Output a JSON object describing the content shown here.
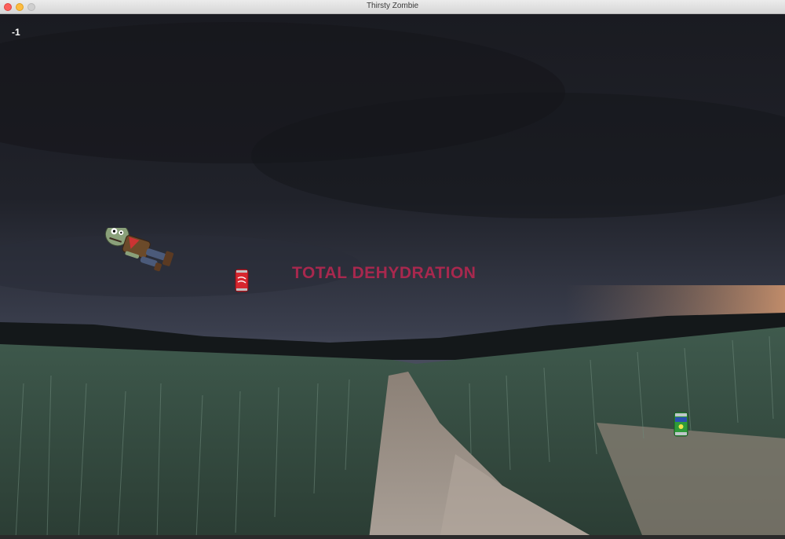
{
  "window": {
    "title": "Thirsty Zombie"
  },
  "hud": {
    "score": "-1"
  },
  "message": {
    "text": "TOTAL DEHYDRATION",
    "color": "#a8284e"
  },
  "sprites": {
    "player": "zombie-character",
    "cola_can": "cola-can",
    "soda_can": "green-soda-can"
  },
  "colors": {
    "sky": "#23252e",
    "field": "#4e6a5c",
    "path": "#a89c90"
  }
}
